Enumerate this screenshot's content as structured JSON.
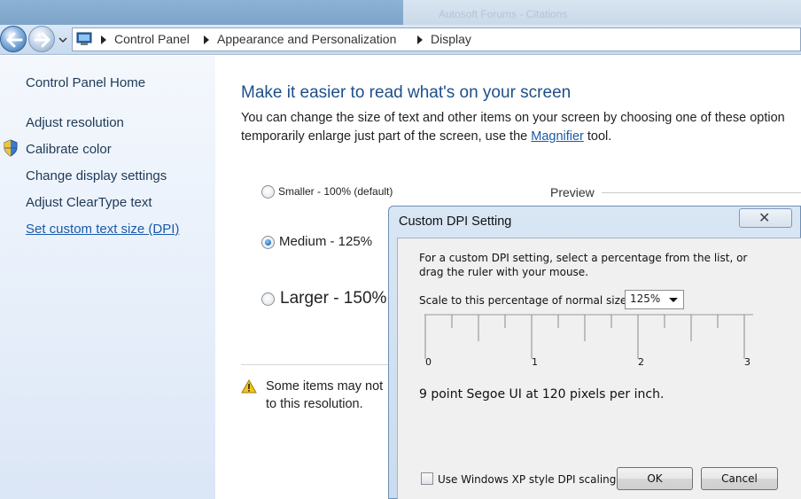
{
  "address_bar": {
    "segments": [
      "Control Panel",
      "Appearance and Personalization",
      "Display"
    ]
  },
  "sidebar": {
    "home": "Control Panel Home",
    "items": [
      {
        "label": "Adjust resolution"
      },
      {
        "label": "Calibrate color",
        "icon": "uac-shield-icon"
      },
      {
        "label": "Change display settings"
      },
      {
        "label": "Adjust ClearType text"
      },
      {
        "label": "Set custom text size (DPI)",
        "link": true
      }
    ]
  },
  "main": {
    "heading": "Make it easier to read what's on your screen",
    "description_line1": "You can change the size of text and other items on your screen by choosing one of these option",
    "description_line2_pre": "temporarily enlarge just part of the screen, use the ",
    "description_link": "Magnifier",
    "description_line2_post": " tool.",
    "options": [
      {
        "label": "Smaller - 100% (default)",
        "checked": false
      },
      {
        "label": "Medium - 125%",
        "checked": true
      },
      {
        "label": "Larger - 150%",
        "checked": false
      }
    ],
    "preview_label": "Preview",
    "warning_line1": "Some items may not",
    "warning_line2": "to this resolution."
  },
  "dialog": {
    "title": "Custom DPI Setting",
    "close_glyph": "✕",
    "instruction_line1": "For a custom DPI setting, select a percentage from the list, or",
    "instruction_line2": "drag the ruler with your mouse.",
    "scale_label": "Scale to this percentage of normal size:",
    "scale_value": "125%",
    "ruler_labels": [
      "0",
      "1",
      "2",
      "3"
    ],
    "dpi_text": "9 point Segoe UI at 120 pixels per inch.",
    "xp_scaling_label": "Use Windows XP style DPI scaling",
    "xp_scaling_checked": false,
    "ok_label": "OK",
    "cancel_label": "Cancel"
  },
  "background_window": {
    "text": "Autosoft Forums - Citations"
  }
}
